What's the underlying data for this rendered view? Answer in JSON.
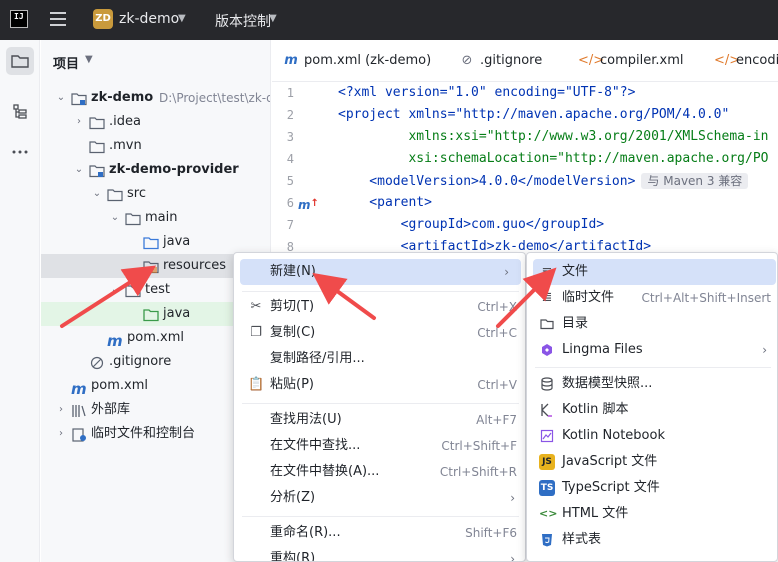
{
  "titlebar": {
    "logo": "IJ",
    "project_badge": "ZD",
    "project_name": "zk-demo",
    "vcs_label": "版本控制"
  },
  "project_panel": {
    "header": "项目",
    "tree": [
      {
        "label": "zk-demo",
        "path": "D:\\Project\\test\\zk-de",
        "bold": true,
        "arrow": "expanded",
        "icon": "module-folder-icon"
      },
      {
        "label": ".idea",
        "arrow": "collapsed",
        "icon": "folder-icon"
      },
      {
        "label": ".mvn",
        "arrow": "none",
        "icon": "folder-icon"
      },
      {
        "label": "zk-demo-provider",
        "bold": true,
        "arrow": "expanded",
        "icon": "module-folder-icon"
      },
      {
        "label": "src",
        "arrow": "expanded",
        "icon": "folder-icon"
      },
      {
        "label": "main",
        "arrow": "expanded",
        "icon": "folder-icon"
      },
      {
        "label": "java",
        "arrow": "none",
        "icon": "source-folder-icon"
      },
      {
        "label": "resources",
        "arrow": "none",
        "icon": "resources-folder-icon",
        "selected": true
      },
      {
        "label": "test",
        "arrow": "expanded",
        "icon": "folder-icon"
      },
      {
        "label": "java",
        "arrow": "none",
        "icon": "test-source-folder-icon",
        "test": true
      },
      {
        "label": "pom.xml",
        "arrow": "none",
        "icon": "maven-icon"
      },
      {
        "label": ".gitignore",
        "arrow": "none",
        "icon": "gitignore-icon"
      },
      {
        "label": "pom.xml",
        "arrow": "none",
        "icon": "maven-icon"
      },
      {
        "label": "外部库",
        "arrow": "collapsed",
        "icon": "library-icon"
      },
      {
        "label": "临时文件和控制台",
        "arrow": "collapsed",
        "icon": "scratch-icon"
      }
    ]
  },
  "tabs": [
    {
      "label": "pom.xml (zk-demo)",
      "icon": "maven-icon"
    },
    {
      "label": ".gitignore",
      "icon": "gitignore-icon"
    },
    {
      "label": "compiler.xml",
      "icon": "xml-icon"
    },
    {
      "label": "encodin",
      "icon": "xml-icon"
    }
  ],
  "editor": {
    "line_numbers": [
      "1",
      "2",
      "3",
      "4",
      "5",
      "6",
      "7",
      "8"
    ],
    "lines": {
      "l1": "<?xml version=\"1.0\" encoding=\"UTF-8\"?>",
      "l2": "<project xmlns=\"http://maven.apache.org/POM/4.0.0\"",
      "l3": "         xmlns:xsi=\"http://www.w3.org/2001/XMLSchema-in",
      "l4": "         xsi:schemaLocation=\"http://maven.apache.org/PO",
      "l5": "    <modelVersion>4.0.0</modelVersion>",
      "l6": "    <parent>",
      "l7": "        <groupId>com.guo</groupId>",
      "l8": "        <artifactId>zk-demo</artifactId>"
    },
    "inline_hint": "与 Maven 3 兼容"
  },
  "context_menu": {
    "items": [
      {
        "label": "新建(N)",
        "submenu": true,
        "highlighted": true
      },
      {
        "label": "剪切(T)",
        "shortcut": "Ctrl+X",
        "icon": "scissors-icon"
      },
      {
        "label": "复制(C)",
        "shortcut": "Ctrl+C",
        "icon": "copy-icon"
      },
      {
        "label": "复制路径/引用..."
      },
      {
        "label": "粘贴(P)",
        "shortcut": "Ctrl+V",
        "icon": "paste-icon"
      },
      {
        "label": "查找用法(U)",
        "shortcut": "Alt+F7"
      },
      {
        "label": "在文件中查找...",
        "shortcut": "Ctrl+Shift+F"
      },
      {
        "label": "在文件中替换(A)...",
        "shortcut": "Ctrl+Shift+R"
      },
      {
        "label": "分析(Z)",
        "submenu": true
      },
      {
        "label": "重命名(R)...",
        "shortcut": "Shift+F6"
      },
      {
        "label": "重构(R)",
        "submenu": true
      }
    ]
  },
  "new_submenu": {
    "items": [
      {
        "label": "文件",
        "icon": "file-icon",
        "highlighted": true
      },
      {
        "label": "临时文件",
        "shortcut": "Ctrl+Alt+Shift+Insert",
        "icon": "scratch-file-icon"
      },
      {
        "label": "目录",
        "icon": "folder-icon"
      },
      {
        "label": "Lingma Files",
        "icon": "lingma-icon",
        "submenu": true
      },
      {
        "label": "数据模型快照...",
        "icon": "database-icon"
      },
      {
        "label": "Kotlin 脚本",
        "icon": "kotlin-icon"
      },
      {
        "label": "Kotlin Notebook",
        "icon": "notebook-icon"
      },
      {
        "label": "JavaScript 文件",
        "icon": "javascript-icon",
        "badge": "JS"
      },
      {
        "label": "TypeScript 文件",
        "icon": "typescript-icon",
        "badge": "TS"
      },
      {
        "label": "HTML 文件",
        "icon": "html-icon"
      },
      {
        "label": "样式表",
        "icon": "css-icon"
      }
    ]
  },
  "colors": {
    "titlebar_bg": "#27282c",
    "selection": "#dfe1e5",
    "menu_highlight": "#d5e1f9",
    "annotation_arrow": "#f04b4b"
  }
}
